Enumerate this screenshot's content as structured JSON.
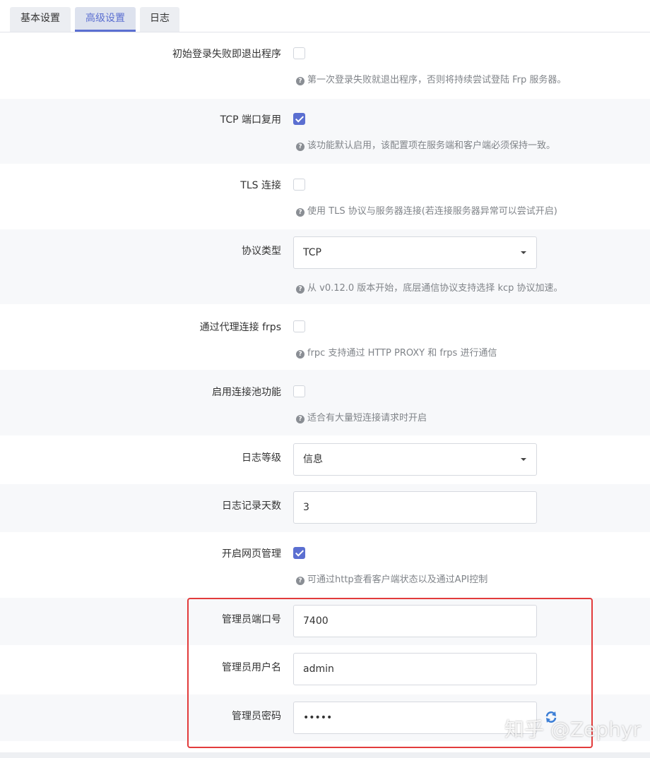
{
  "tabs": [
    {
      "label": "基本设置",
      "active": false
    },
    {
      "label": "高级设置",
      "active": true
    },
    {
      "label": "日志",
      "active": false
    }
  ],
  "settings": {
    "login_fail_exit": {
      "label": "初始登录失败即退出程序",
      "checked": false,
      "hint": "第一次登录失败就退出程序，否则将持续尝试登陆 Frp 服务器。"
    },
    "tcp_mux": {
      "label": "TCP 端口复用",
      "checked": true,
      "hint": "该功能默认启用，该配置项在服务端和客户端必须保持一致。"
    },
    "tls": {
      "label": "TLS 连接",
      "checked": false,
      "hint": "使用 TLS 协议与服务器连接(若连接服务器异常可以尝试开启)"
    },
    "protocol": {
      "label": "协议类型",
      "value": "TCP",
      "hint": "从 v0.12.0 版本开始，底层通信协议支持选择 kcp 协议加速。"
    },
    "proxy": {
      "label": "通过代理连接 frps",
      "checked": false,
      "hint": "frpc 支持通过 HTTP PROXY 和 frps 进行通信"
    },
    "pool": {
      "label": "启用连接池功能",
      "checked": false,
      "hint": "适合有大量短连接请求时开启"
    },
    "log_level": {
      "label": "日志等级",
      "value": "信息"
    },
    "log_days": {
      "label": "日志记录天数",
      "value": "3"
    },
    "web_admin": {
      "label": "开启网页管理",
      "checked": true,
      "hint": "可通过http查看客户端状态以及通过API控制"
    },
    "admin_port": {
      "label": "管理员端口号",
      "value": "7400"
    },
    "admin_user": {
      "label": "管理员用户名",
      "value": "admin"
    },
    "admin_pwd": {
      "label": "管理员密码",
      "value": "•••••"
    }
  },
  "hint_icon": "?",
  "watermark": "知乎 @Zephyr",
  "colors": {
    "accent": "#5b6fd1",
    "highlight": "#e23b3b"
  },
  "icons": {
    "refresh": "refresh-icon",
    "help": "question-circle-icon"
  }
}
